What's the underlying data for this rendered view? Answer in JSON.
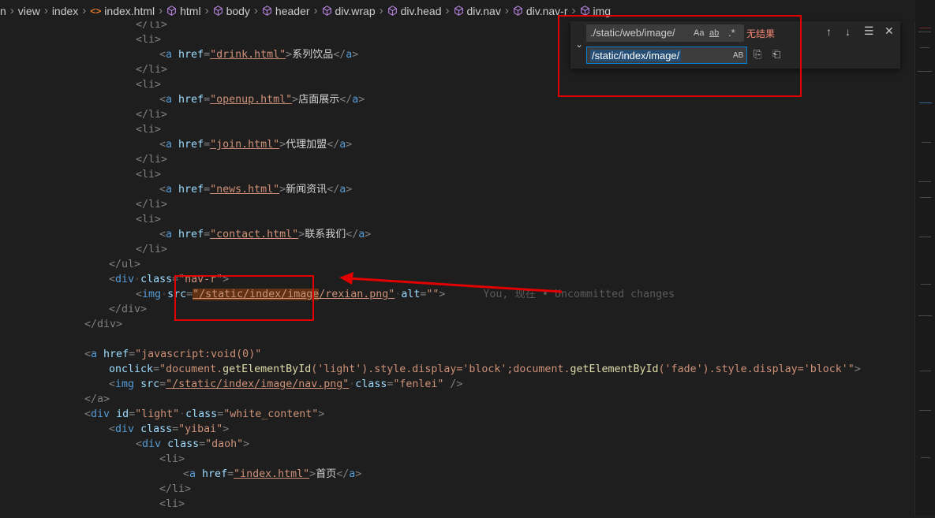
{
  "breadcrumb": [
    "n",
    "view",
    "index",
    "index.html",
    "html",
    "body",
    "header",
    "div.wrap",
    "div.head",
    "div.nav",
    "div.nav-r",
    "img"
  ],
  "find": {
    "search_value": "./static/web/image/",
    "match_case_label": "Aa",
    "whole_word_label": "ab",
    "regex_label": ".*",
    "no_results": "无结果",
    "replace_value": "/static/index/image/",
    "preserve_case_label": "AB"
  },
  "code": {
    "l1_tag": "</li>",
    "l2_tag": "<li>",
    "l3_href": "\"drink.html\"",
    "l3_text": "系列饮品",
    "l4_tag": "</li>",
    "l5_tag": "<li>",
    "l6_href": "\"openup.html\"",
    "l6_text": "店面展示",
    "l7_tag": "</li>",
    "l8_tag": "<li>",
    "l9_href": "\"join.html\"",
    "l9_text": "代理加盟",
    "l10_tag": "</li>",
    "l11_tag": "<li>",
    "l12_href": "\"news.html\"",
    "l12_text": "新闻资讯",
    "l13_tag": "</li>",
    "l14_tag": "<li>",
    "l15_href": "\"contact.html\"",
    "l15_text": "联系我们",
    "l16_tag": "</li>",
    "l17_tag": "</ul>",
    "l18_class": "\"nav-r\"",
    "l19_src_a": "\"/static/index/image",
    "l19_src_b": "/rexian.png\"",
    "l19_alt": "\"\"",
    "blame": "You, 现在 • Uncommitted changes",
    "l20_tag": "</div>",
    "l21_tag": "</div>",
    "l23_href": "\"javascript:void(0)\"",
    "l24_onclick_a": "\"document.",
    "l24_fn1": "getElementById",
    "l24_arg1": "('light')",
    "l24_mid": ".style.display=",
    "l24_block1": "'block';",
    "l24_doc2": "document.",
    "l24_fn2": "getElementById",
    "l24_arg2": "('fade')",
    "l24_mid2": ".style.display=",
    "l24_block2": "'block'\"",
    "l25_src": "\"/static/index/image/nav.png\"",
    "l25_class": "\"fenlei\"",
    "l26_tag": "</a>",
    "l27_id": "\"light\"",
    "l27_class": "\"white_content\"",
    "l28_class": "\"yibai\"",
    "l29_class": "\"daoh\"",
    "l30_tag": "<li>",
    "l31_href": "\"index.html\"",
    "l31_text": "首页",
    "l32_tag": "</li>",
    "l33_tag": "<li>"
  }
}
